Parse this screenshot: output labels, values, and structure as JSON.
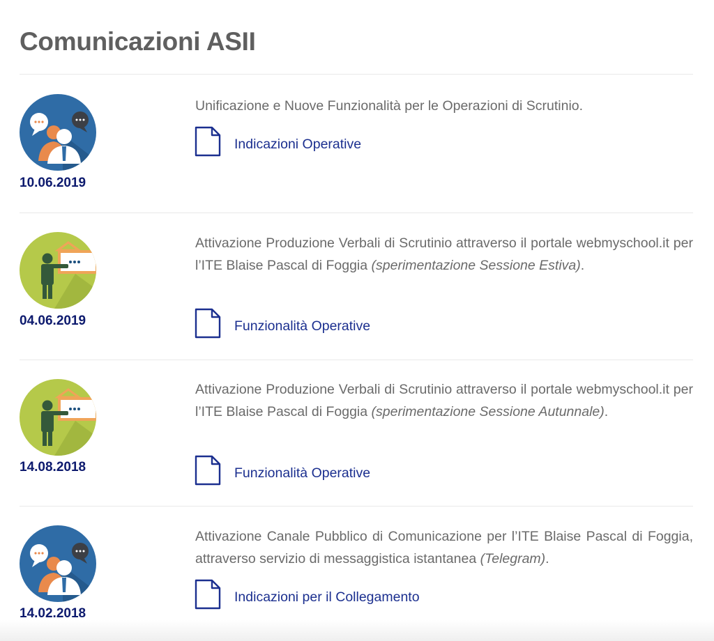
{
  "page": {
    "title": "Comunicazioni ASII"
  },
  "colors": {
    "title": "#5f5f5f",
    "date": "#0d1a6e",
    "link": "#1b2f8f",
    "body_text": "#6a6a6a",
    "meeting_icon_bg": "#2f6ca6",
    "teacher_icon_bg": "#b5c94a"
  },
  "entries": [
    {
      "icon": "meeting-icon",
      "date": "10.06.2019",
      "text_plain": "Unificazione e Nuove Funzionalità per le Operazioni di Scrutinio.",
      "text_italic": "",
      "text_end": "",
      "link_label": "Indicazioni Operative"
    },
    {
      "icon": "teacher-icon",
      "date": "04.06.2019",
      "text_plain": "Attivazione Produzione Verbali di Scrutinio attraverso il portale webmyschool.it per l’ITE Blaise Pascal di Foggia ",
      "text_italic": "(sperimentazione Sessione Estiva)",
      "text_end": ".",
      "link_label": "Funzionalità Operative"
    },
    {
      "icon": "teacher-icon",
      "date": "14.08.2018",
      "text_plain": "Attivazione Produzione Verbali di Scrutinio attraverso il portale webmyschool.it per l’ITE Blaise Pascal di Foggia ",
      "text_italic": "(sperimentazione Sessione Autunnale)",
      "text_end": ".",
      "link_label": "Funzionalità Operative"
    },
    {
      "icon": "meeting-icon",
      "date": "14.02.2018",
      "text_plain": "Attivazione Canale Pubblico di Comunicazione per l’ITE Blaise Pascal di Foggia, attraverso servizio di messaggistica istantanea ",
      "text_italic": "(Telegram)",
      "text_end": ".",
      "link_label": "Indicazioni per il Collegamento"
    }
  ]
}
